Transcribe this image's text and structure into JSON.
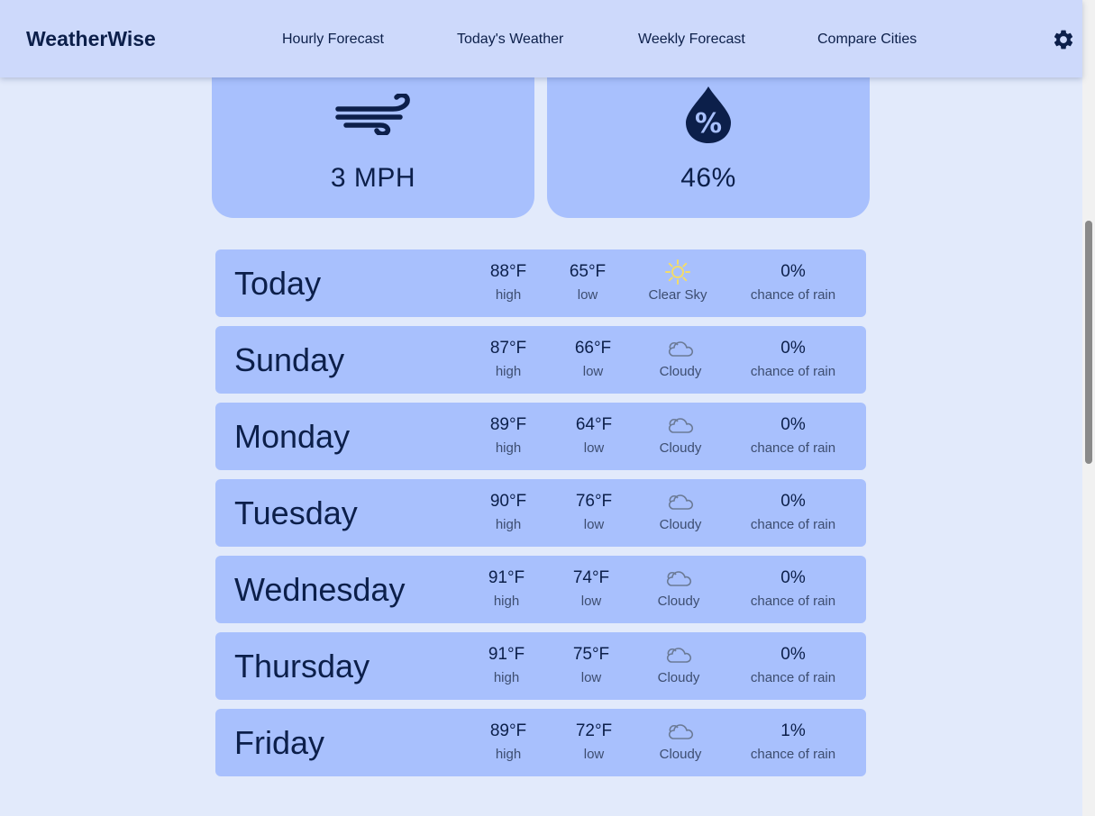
{
  "header": {
    "brand": "WeatherWise",
    "nav": [
      "Hourly Forecast",
      "Today's Weather",
      "Weekly Forecast",
      "Compare Cities"
    ],
    "settings_icon": "gear-icon"
  },
  "metrics": {
    "wind": {
      "icon": "wind-icon",
      "value": "3 MPH"
    },
    "humidity": {
      "icon": "humidity-drop-icon",
      "value": "46%"
    }
  },
  "forecast": [
    {
      "day": "Today",
      "high": "88°F",
      "high_label": "high",
      "low": "65°F",
      "low_label": "low",
      "icon": "sun-icon",
      "condition": "Clear Sky",
      "rain": "0%",
      "rain_label": "chance of rain"
    },
    {
      "day": "Sunday",
      "high": "87°F",
      "high_label": "high",
      "low": "66°F",
      "low_label": "low",
      "icon": "cloud-icon",
      "condition": "Cloudy",
      "rain": "0%",
      "rain_label": "chance of rain"
    },
    {
      "day": "Monday",
      "high": "89°F",
      "high_label": "high",
      "low": "64°F",
      "low_label": "low",
      "icon": "cloud-icon",
      "condition": "Cloudy",
      "rain": "0%",
      "rain_label": "chance of rain"
    },
    {
      "day": "Tuesday",
      "high": "90°F",
      "high_label": "high",
      "low": "76°F",
      "low_label": "low",
      "icon": "cloud-icon",
      "condition": "Cloudy",
      "rain": "0%",
      "rain_label": "chance of rain"
    },
    {
      "day": "Wednesday",
      "high": "91°F",
      "high_label": "high",
      "low": "74°F",
      "low_label": "low",
      "icon": "cloud-icon",
      "condition": "Cloudy",
      "rain": "0%",
      "rain_label": "chance of rain"
    },
    {
      "day": "Thursday",
      "high": "91°F",
      "high_label": "high",
      "low": "75°F",
      "low_label": "low",
      "icon": "cloud-icon",
      "condition": "Cloudy",
      "rain": "0%",
      "rain_label": "chance of rain"
    },
    {
      "day": "Friday",
      "high": "89°F",
      "high_label": "high",
      "low": "72°F",
      "low_label": "low",
      "icon": "cloud-icon",
      "condition": "Cloudy",
      "rain": "1%",
      "rain_label": "chance of rain"
    }
  ],
  "colors": {
    "background": "#e2eafb",
    "header": "#cdd9fb",
    "card": "#a8c0fd",
    "text": "#0c1f4a",
    "sun": "#f2dc6b"
  }
}
